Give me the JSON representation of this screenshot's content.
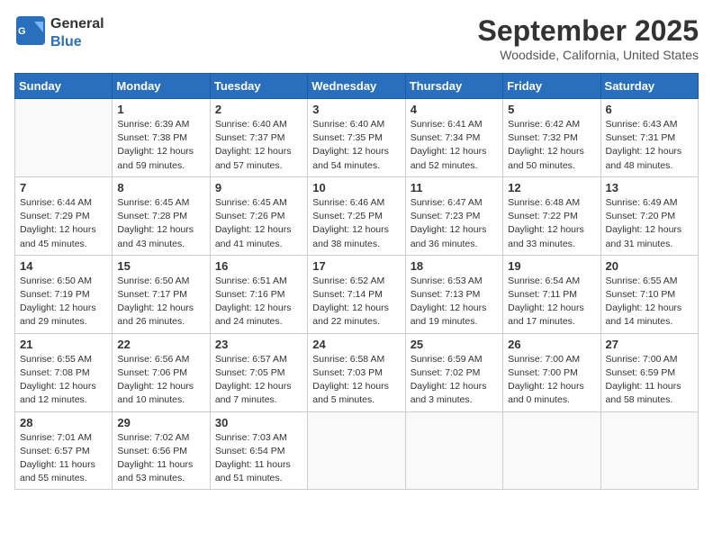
{
  "header": {
    "logo_line1": "General",
    "logo_line2": "Blue",
    "month_title": "September 2025",
    "location": "Woodside, California, United States"
  },
  "days_of_week": [
    "Sunday",
    "Monday",
    "Tuesday",
    "Wednesday",
    "Thursday",
    "Friday",
    "Saturday"
  ],
  "weeks": [
    [
      {
        "day": "",
        "info": ""
      },
      {
        "day": "1",
        "info": "Sunrise: 6:39 AM\nSunset: 7:38 PM\nDaylight: 12 hours\nand 59 minutes."
      },
      {
        "day": "2",
        "info": "Sunrise: 6:40 AM\nSunset: 7:37 PM\nDaylight: 12 hours\nand 57 minutes."
      },
      {
        "day": "3",
        "info": "Sunrise: 6:40 AM\nSunset: 7:35 PM\nDaylight: 12 hours\nand 54 minutes."
      },
      {
        "day": "4",
        "info": "Sunrise: 6:41 AM\nSunset: 7:34 PM\nDaylight: 12 hours\nand 52 minutes."
      },
      {
        "day": "5",
        "info": "Sunrise: 6:42 AM\nSunset: 7:32 PM\nDaylight: 12 hours\nand 50 minutes."
      },
      {
        "day": "6",
        "info": "Sunrise: 6:43 AM\nSunset: 7:31 PM\nDaylight: 12 hours\nand 48 minutes."
      }
    ],
    [
      {
        "day": "7",
        "info": "Sunrise: 6:44 AM\nSunset: 7:29 PM\nDaylight: 12 hours\nand 45 minutes."
      },
      {
        "day": "8",
        "info": "Sunrise: 6:45 AM\nSunset: 7:28 PM\nDaylight: 12 hours\nand 43 minutes."
      },
      {
        "day": "9",
        "info": "Sunrise: 6:45 AM\nSunset: 7:26 PM\nDaylight: 12 hours\nand 41 minutes."
      },
      {
        "day": "10",
        "info": "Sunrise: 6:46 AM\nSunset: 7:25 PM\nDaylight: 12 hours\nand 38 minutes."
      },
      {
        "day": "11",
        "info": "Sunrise: 6:47 AM\nSunset: 7:23 PM\nDaylight: 12 hours\nand 36 minutes."
      },
      {
        "day": "12",
        "info": "Sunrise: 6:48 AM\nSunset: 7:22 PM\nDaylight: 12 hours\nand 33 minutes."
      },
      {
        "day": "13",
        "info": "Sunrise: 6:49 AM\nSunset: 7:20 PM\nDaylight: 12 hours\nand 31 minutes."
      }
    ],
    [
      {
        "day": "14",
        "info": "Sunrise: 6:50 AM\nSunset: 7:19 PM\nDaylight: 12 hours\nand 29 minutes."
      },
      {
        "day": "15",
        "info": "Sunrise: 6:50 AM\nSunset: 7:17 PM\nDaylight: 12 hours\nand 26 minutes."
      },
      {
        "day": "16",
        "info": "Sunrise: 6:51 AM\nSunset: 7:16 PM\nDaylight: 12 hours\nand 24 minutes."
      },
      {
        "day": "17",
        "info": "Sunrise: 6:52 AM\nSunset: 7:14 PM\nDaylight: 12 hours\nand 22 minutes."
      },
      {
        "day": "18",
        "info": "Sunrise: 6:53 AM\nSunset: 7:13 PM\nDaylight: 12 hours\nand 19 minutes."
      },
      {
        "day": "19",
        "info": "Sunrise: 6:54 AM\nSunset: 7:11 PM\nDaylight: 12 hours\nand 17 minutes."
      },
      {
        "day": "20",
        "info": "Sunrise: 6:55 AM\nSunset: 7:10 PM\nDaylight: 12 hours\nand 14 minutes."
      }
    ],
    [
      {
        "day": "21",
        "info": "Sunrise: 6:55 AM\nSunset: 7:08 PM\nDaylight: 12 hours\nand 12 minutes."
      },
      {
        "day": "22",
        "info": "Sunrise: 6:56 AM\nSunset: 7:06 PM\nDaylight: 12 hours\nand 10 minutes."
      },
      {
        "day": "23",
        "info": "Sunrise: 6:57 AM\nSunset: 7:05 PM\nDaylight: 12 hours\nand 7 minutes."
      },
      {
        "day": "24",
        "info": "Sunrise: 6:58 AM\nSunset: 7:03 PM\nDaylight: 12 hours\nand 5 minutes."
      },
      {
        "day": "25",
        "info": "Sunrise: 6:59 AM\nSunset: 7:02 PM\nDaylight: 12 hours\nand 3 minutes."
      },
      {
        "day": "26",
        "info": "Sunrise: 7:00 AM\nSunset: 7:00 PM\nDaylight: 12 hours\nand 0 minutes."
      },
      {
        "day": "27",
        "info": "Sunrise: 7:00 AM\nSunset: 6:59 PM\nDaylight: 11 hours\nand 58 minutes."
      }
    ],
    [
      {
        "day": "28",
        "info": "Sunrise: 7:01 AM\nSunset: 6:57 PM\nDaylight: 11 hours\nand 55 minutes."
      },
      {
        "day": "29",
        "info": "Sunrise: 7:02 AM\nSunset: 6:56 PM\nDaylight: 11 hours\nand 53 minutes."
      },
      {
        "day": "30",
        "info": "Sunrise: 7:03 AM\nSunset: 6:54 PM\nDaylight: 11 hours\nand 51 minutes."
      },
      {
        "day": "",
        "info": ""
      },
      {
        "day": "",
        "info": ""
      },
      {
        "day": "",
        "info": ""
      },
      {
        "day": "",
        "info": ""
      }
    ]
  ]
}
